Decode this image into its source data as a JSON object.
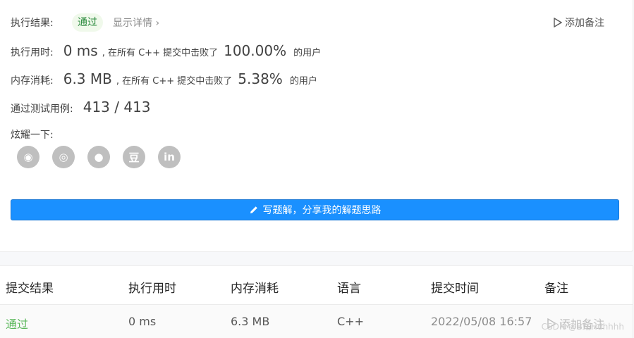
{
  "result": {
    "label": "执行结果:",
    "status": "通过",
    "details_link": "显示详情 ›",
    "add_note": "添加备注"
  },
  "runtime": {
    "label": "执行用时:",
    "value": "0 ms",
    "mid_text": ", 在所有 C++ 提交中击败了",
    "percent": "100.00%",
    "suffix": "的用户"
  },
  "memory": {
    "label": "内存消耗:",
    "value": "6.3 MB",
    "mid_text": ", 在所有 C++ 提交中击败了",
    "percent": "5.38%",
    "suffix": "的用户"
  },
  "tests": {
    "label": "通过测试用例:",
    "value": "413 / 413"
  },
  "share": {
    "label": "炫耀一下:",
    "icons": [
      "wechat-icon",
      "weibo-icon",
      "qq-icon",
      "douban-icon",
      "linkedin-icon"
    ],
    "icon_glyphs": [
      "◉",
      "◎",
      "●",
      "豆",
      "in"
    ]
  },
  "write_button": {
    "label": "写题解，分享我的解题思路"
  },
  "table": {
    "headers": [
      "提交结果",
      "执行用时",
      "内存消耗",
      "语言",
      "提交时间",
      "备注"
    ],
    "row": {
      "result": "通过",
      "runtime": "0 ms",
      "memory": "6.3 MB",
      "language": "C++",
      "time": "2022/05/08 16:57",
      "note": "添加备注"
    }
  },
  "watermark": "CSDN @B站Hdhhhh",
  "colors": {
    "accent": "#1a90ff",
    "pass": "#5cb85c",
    "pill_bg": "#f0f9eb"
  }
}
